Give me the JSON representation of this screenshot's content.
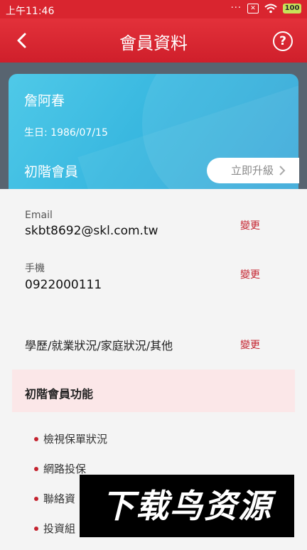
{
  "status_bar": {
    "time": "上午11:46",
    "dots": "···",
    "battery": "100"
  },
  "header": {
    "title": "會員資料",
    "help_glyph": "?"
  },
  "member": {
    "name": "詹阿春",
    "birthday": "生日: 1986/07/15",
    "level": "初階會員",
    "upgrade_label": "立即升級"
  },
  "fields": {
    "email": {
      "label": "Email",
      "value": "skbt8692@skl.com.tw",
      "action": "變更"
    },
    "phone": {
      "label": "手機",
      "value": "0922000111",
      "action": "變更"
    },
    "other": {
      "label": "學歷/就業狀況/家庭狀況/其他",
      "action": "變更"
    }
  },
  "section": {
    "title": "初階會員功能",
    "items": [
      "檢視保單狀況",
      "網路投保",
      "聯絡資",
      "投資組"
    ]
  },
  "watermark": "下载鸟资源",
  "colors": {
    "brand_red": "#d9252f",
    "card_blue": "#39b8e0",
    "section_bg": "#fbe7e8"
  }
}
